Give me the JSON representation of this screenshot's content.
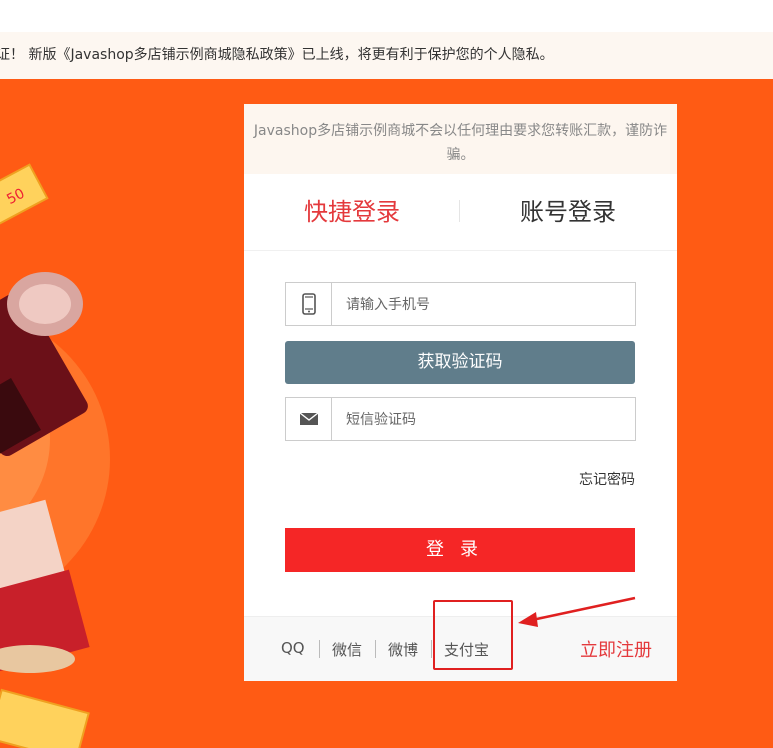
{
  "notice": {
    "text": "证！ 新版《Javashop多店铺示例商城隐私政策》已上线，将更有利于保护您的个人隐私。"
  },
  "panel": {
    "warning": "Javashop多店铺示例商城不会以任何理由要求您转账汇款，谨防诈骗。",
    "tabs": {
      "quick": "快捷登录",
      "account": "账号登录"
    },
    "phone": {
      "placeholder": "请输入手机号",
      "icon": "mobile-phone-icon"
    },
    "get_code_label": "获取验证码",
    "sms": {
      "placeholder": "短信验证码",
      "icon": "envelope-icon"
    },
    "forgot_label": "忘记密码",
    "login_label": "登录",
    "footer": {
      "links": [
        "QQ",
        "微信",
        "微博",
        "支付宝"
      ],
      "register_label": "立即注册"
    }
  },
  "colors": {
    "banner": "#ff5b14",
    "accent_red": "#e4393c",
    "login_button": "#f52626",
    "code_button": "#607d8b",
    "annotation": "#e02020"
  }
}
